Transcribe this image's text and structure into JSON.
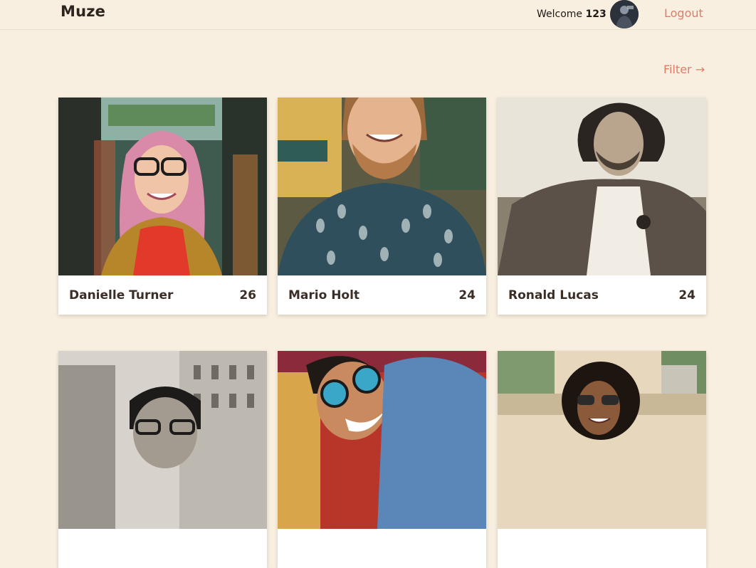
{
  "header": {
    "brand": "Muze",
    "welcome_text": "Welcome",
    "username": "123",
    "logout_label": "Logout"
  },
  "filter_label": "Filter →",
  "profiles": [
    {
      "name": "Danielle Turner",
      "age": "26"
    },
    {
      "name": "Mario Holt",
      "age": "24"
    },
    {
      "name": "Ronald Lucas",
      "age": "24"
    },
    {
      "name": "",
      "age": ""
    },
    {
      "name": "",
      "age": ""
    },
    {
      "name": "",
      "age": ""
    }
  ],
  "colors": {
    "background": "#f8efe0",
    "accent": "#e07b68",
    "text": "#3a2e27"
  }
}
